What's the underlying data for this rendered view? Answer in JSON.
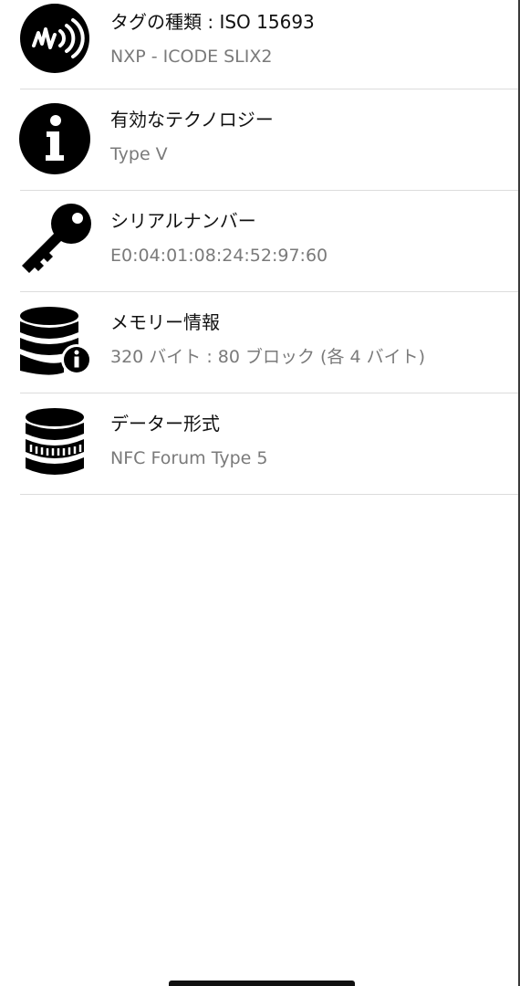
{
  "items": [
    {
      "icon": "nfc-waves-icon",
      "title": "タグの種類 : ISO 15693",
      "subtitle": "NXP - ICODE SLIX2"
    },
    {
      "icon": "info-icon",
      "title": "有効なテクノロジー",
      "subtitle": "Type V"
    },
    {
      "icon": "key-icon",
      "title": "シリアルナンバー",
      "subtitle": "E0:04:01:08:24:52:97:60"
    },
    {
      "icon": "database-info-icon",
      "title": "メモリー情報",
      "subtitle": "320 バイト : 80 ブロック (各 4 バイト)"
    },
    {
      "icon": "database-icon",
      "title": "データー形式",
      "subtitle": "NFC Forum Type 5"
    }
  ]
}
